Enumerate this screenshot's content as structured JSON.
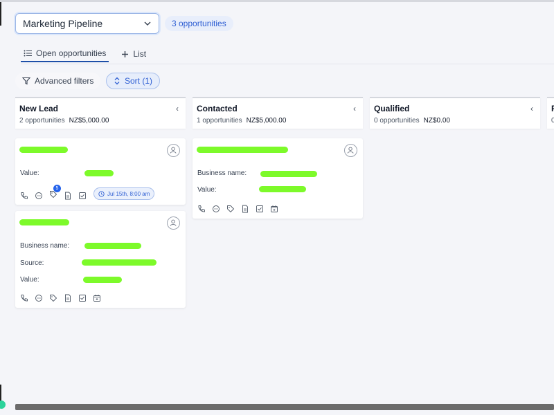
{
  "pipeline": {
    "selected": "Marketing Pipeline",
    "count_label": "3 opportunities"
  },
  "tabs": [
    {
      "label": "Open opportunities",
      "active": true,
      "icon": "list-bullets-icon"
    },
    {
      "label": "List",
      "active": false,
      "icon": "plus-icon"
    }
  ],
  "filters": {
    "advanced_label": "Advanced filters",
    "sort_label": "Sort (1)"
  },
  "columns": [
    {
      "name": "New Lead",
      "count": "2 opportunities",
      "amount": "NZ$5,000.00"
    },
    {
      "name": "Contacted",
      "count": "1 opportunities",
      "amount": "NZ$5,000.00"
    },
    {
      "name": "Qualified",
      "count": "0 opportunities",
      "amount": "NZ$0.00"
    },
    {
      "name": "P",
      "count": "0",
      "amount": ""
    }
  ],
  "cards": {
    "c1": {
      "value_label": "Value:",
      "notification_count": "5",
      "date_label": "Jul 15th, 8:00 am"
    },
    "c2": {
      "business_label": "Business name:",
      "source_label": "Source:",
      "value_label": "Value:"
    },
    "c3": {
      "business_label": "Business name:",
      "value_label": "Value:"
    }
  },
  "colors": {
    "accent": "#2f5fd3",
    "redaction": "#7dfa2a",
    "badge": "#2563eb"
  }
}
